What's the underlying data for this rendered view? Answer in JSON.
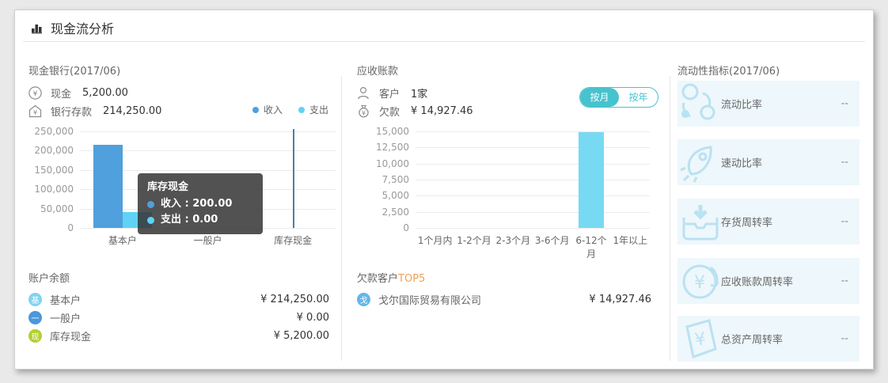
{
  "page": {
    "title": "现金流分析"
  },
  "cash_bank": {
    "header": "现金银行(2017/06)",
    "stats": [
      {
        "icon": "yen-circle-icon",
        "label": "现金",
        "value": "5,200.00"
      },
      {
        "icon": "bank-icon",
        "label": "银行存款",
        "value": "214,250.00"
      }
    ],
    "tooltip": {
      "title": "库存现金",
      "rows": [
        {
          "text": "收入 : 200.00",
          "color": "#4fa0dc"
        },
        {
          "text": "支出 : 0.00",
          "color": "#5fd2f5"
        }
      ]
    }
  },
  "account_balance": {
    "header": "账户余额",
    "rows": [
      {
        "badge": "基",
        "badge_color": "#82d2ef",
        "label": "基本户",
        "value": "¥ 214,250.00"
      },
      {
        "badge": "一",
        "badge_color": "#4a97da",
        "label": "一般户",
        "value": "¥ 0.00"
      },
      {
        "badge": "现",
        "badge_color": "#b3cf2f",
        "label": "库存现金",
        "value": "¥ 5,200.00"
      }
    ]
  },
  "receivables": {
    "header": "应收账款",
    "stats": [
      {
        "icon": "customer-icon",
        "label": "客户",
        "value": "1家"
      },
      {
        "icon": "moneybag-icon",
        "label": "欠款",
        "value": "¥ 14,927.46"
      }
    ],
    "period_toggle": {
      "options": [
        "按月",
        "按年"
      ],
      "selected": "按月"
    }
  },
  "debt_customers": {
    "header_prefix": "欠款客户",
    "header_highlight": "TOP5",
    "rows": [
      {
        "badge": "戈",
        "badge_color": "#64b6ea",
        "label": "戈尔国际贸易有限公司",
        "value": "¥ 14,927.46"
      }
    ]
  },
  "liquidity": {
    "header": "流动性指标(2017/06)",
    "items": [
      {
        "icon": "bubbles-icon",
        "label": "流动比率",
        "value": "--"
      },
      {
        "icon": "rocket-icon",
        "label": "速动比率",
        "value": "--"
      },
      {
        "icon": "inventory-icon",
        "label": "存货周转率",
        "value": "--"
      },
      {
        "icon": "receivable-turnover-icon",
        "label": "应收账款周转率",
        "value": "--"
      },
      {
        "icon": "asset-turnover-icon",
        "label": "总资产周转率",
        "value": "--"
      }
    ]
  },
  "chart_data": [
    {
      "type": "bar",
      "title": "现金银行收支",
      "categories": [
        "基本户",
        "一般户",
        "库存现金"
      ],
      "series": [
        {
          "name": "收入",
          "color": "#4fa0dc",
          "values": [
            214250,
            0,
            200
          ]
        },
        {
          "name": "支出",
          "color": "#5fd2f5",
          "values": [
            40000,
            0,
            0
          ]
        }
      ],
      "ylim": [
        0,
        250000
      ],
      "ytick_step": 50000,
      "grid": true,
      "legend_position": "top-right",
      "axis_pointer_index": 2
    },
    {
      "type": "bar",
      "title": "应收账款账龄",
      "categories": [
        "1个月内",
        "1-2个月",
        "2-3个月",
        "3-6个月",
        "6-12个月",
        "1年以上"
      ],
      "series": [
        {
          "name": "欠款",
          "color": "#78d9f3",
          "values": [
            0,
            0,
            0,
            0,
            14927.46,
            0
          ]
        }
      ],
      "ylim": [
        0,
        15000
      ],
      "ytick_step": 2500,
      "grid": true,
      "legend_position": "none"
    }
  ]
}
